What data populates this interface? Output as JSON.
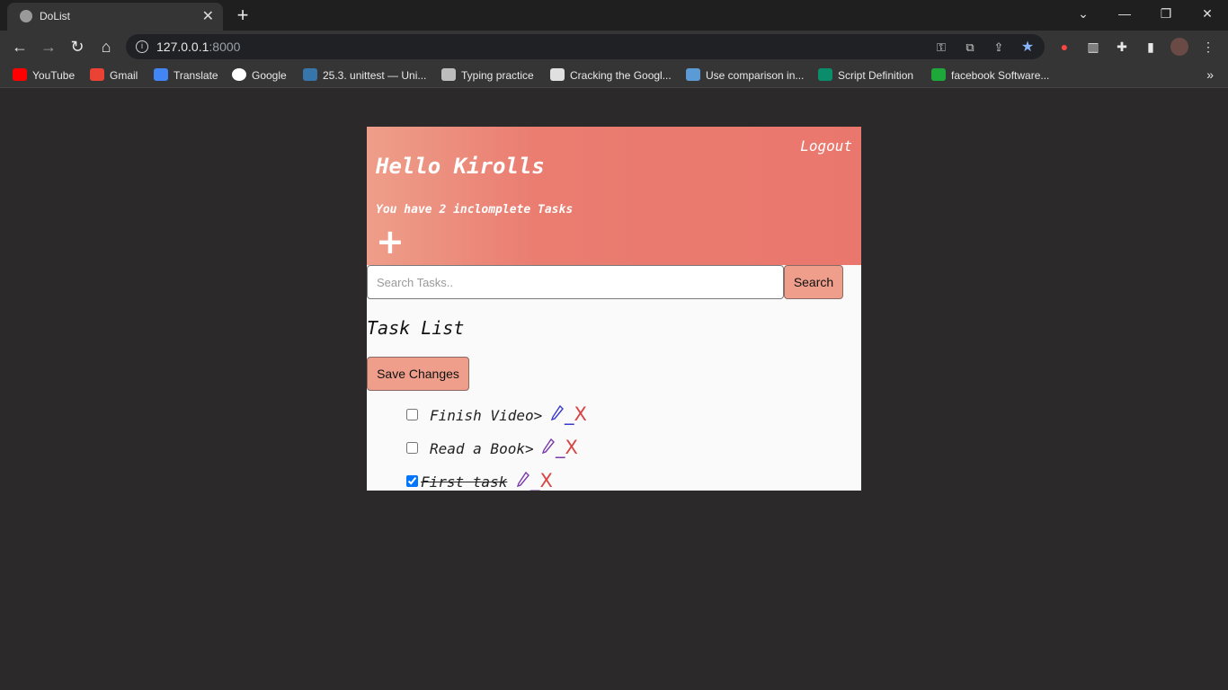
{
  "browser": {
    "tab_title": "DoList",
    "url_host": "127.0.0.1",
    "url_port": ":8000",
    "bookmarks": [
      {
        "label": "YouTube",
        "color": "#ff0000"
      },
      {
        "label": "Gmail",
        "color": "#ea4335"
      },
      {
        "label": "Translate",
        "color": "#4285f4"
      },
      {
        "label": "Google",
        "color": "#ffffff"
      },
      {
        "label": "25.3. unittest — Uni...",
        "color": "#3776ab"
      },
      {
        "label": "Typing practice",
        "color": "#bdbdbd"
      },
      {
        "label": "Cracking the Googl...",
        "color": "#e0e0e0"
      },
      {
        "label": "Use comparison in...",
        "color": "#5b9bd5"
      },
      {
        "label": "Script Definition",
        "color": "#0b8c6a"
      },
      {
        "label": "facebook Software...",
        "color": "#1fa83a"
      }
    ]
  },
  "app": {
    "logout": "Logout",
    "greeting": "Hello Kirolls",
    "incomplete_text": "You have 2 inclomplete Tasks",
    "add_symbol": "+",
    "search_placeholder": "Search Tasks..",
    "search_button": "Search",
    "list_title": "Task List",
    "save_button": "Save Changes",
    "tasks": [
      {
        "text": "Finish Video>",
        "done": false,
        "delete": "X"
      },
      {
        "text": "Read a Book>",
        "done": false,
        "delete": "X"
      },
      {
        "text": "First task",
        "done": true,
        "delete": "X"
      }
    ]
  },
  "colors": {
    "header_accent": "#ea776d",
    "button_accent": "#ee9e8a",
    "delete_red": "#d94444"
  }
}
